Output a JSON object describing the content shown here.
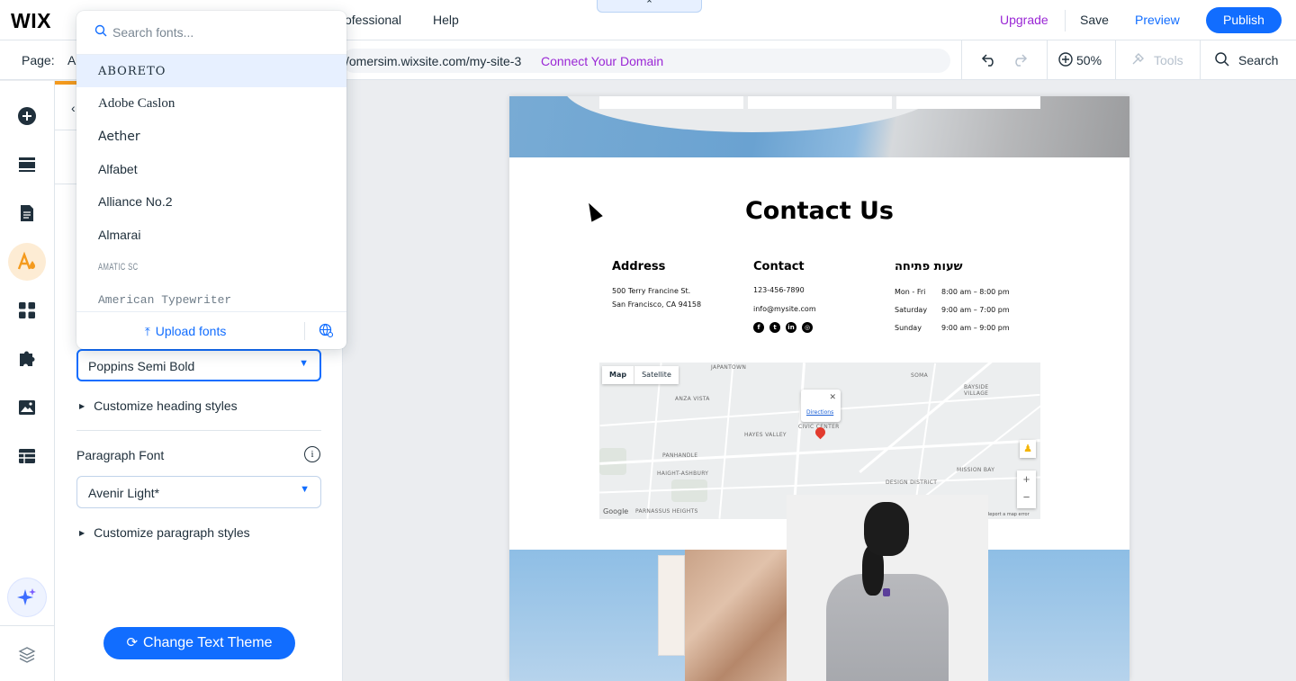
{
  "topbar": {
    "logo": "WIX",
    "menu_partial": "ofessional",
    "help": "Help",
    "collapse": "⌃",
    "upgrade": "Upgrade",
    "save": "Save",
    "preview": "Preview",
    "publish": "Publish"
  },
  "secondbar": {
    "page_label": "Page:",
    "page_value_partial": "A",
    "url": "/omersim.wixsite.com/my-site-3",
    "connect_domain": "Connect Your Domain",
    "zoom": "50%",
    "tools": "Tools",
    "search": "Search"
  },
  "font_picker": {
    "search_placeholder": "Search fonts...",
    "fonts": [
      "ABORETO",
      "Adobe Caslon",
      "Aether",
      "Alfabet",
      "Alliance No.2",
      "Almarai",
      "AMATIC SC",
      "American Typewriter"
    ],
    "highlighted_index": 0,
    "upload_label": "Upload fonts"
  },
  "panel": {
    "heading_font": "Poppins Semi Bold",
    "customize_heading": "Customize heading styles",
    "paragraph_title": "Paragraph Font",
    "paragraph_font": "Avenir Light*",
    "customize_paragraph": "Customize paragraph styles",
    "change_theme": "Change Text Theme"
  },
  "site": {
    "title": "Contact Us",
    "address_head": "Address",
    "address_line1": "500 Terry Francine St.",
    "address_line2": "San Francisco, CA 94158",
    "contact_head": "Contact",
    "phone": "123-456-7890",
    "email": "info@mysite.com",
    "hours_head": "שעות פתיחה",
    "hours": [
      {
        "day": "Mon - Fri",
        "time": "8:00 am – 8:00 pm"
      },
      {
        "day": "Saturday",
        "time": "9:00 am – 7:00 pm"
      },
      {
        "day": "Sunday",
        "time": "9:00 am – 9:00 pm"
      }
    ],
    "map": {
      "tab_map": "Map",
      "tab_satellite": "Satellite",
      "directions": "Directions",
      "google": "Google",
      "report": "Report a map error",
      "labels": [
        "JAPANTOWN",
        "ANZA VISTA",
        "HAYES VALLEY",
        "PANHANDLE",
        "HAIGHT-ASHBURY",
        "CIVIC CENTER",
        "SOMA",
        "MISSION BAY",
        "DESIGN DISTRICT",
        "BAYSIDE VILLAGE",
        "PARNASSUS HEIGHTS"
      ]
    }
  },
  "colors": {
    "accent": "#116dff",
    "upgrade": "#9a27d5",
    "active_rail": "#f49a1d"
  },
  "icons": {
    "rail": [
      "add-icon",
      "sections-icon",
      "pages-icon",
      "design-icon",
      "apps-icon",
      "puzzle-icon",
      "media-icon",
      "cms-icon",
      "ai-assistant-icon",
      "layers-icon"
    ]
  }
}
